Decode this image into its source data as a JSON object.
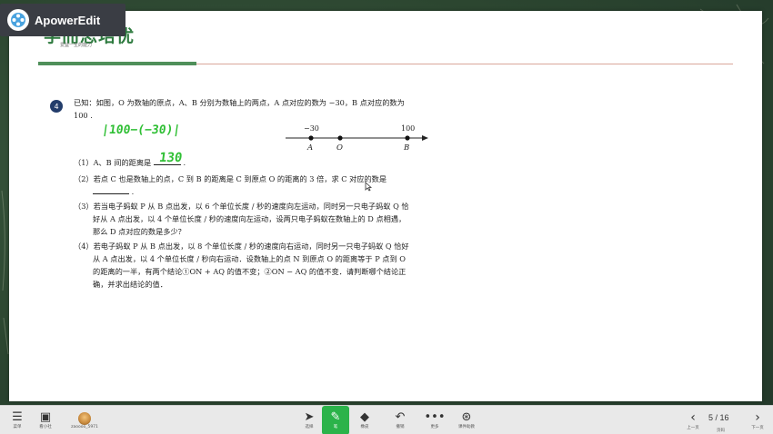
{
  "watermark": {
    "label": "ApowerEdit"
  },
  "slide": {
    "logo": "学而思培优",
    "logo_sub": "爱益一生的能力"
  },
  "problem": {
    "number": "4",
    "intro_line1": "已知：如图，O 为数轴的原点，A、B 分别为数轴上的两点，A 点对应的数为 −30，B 点对应的数为",
    "intro_line2": "100 .",
    "handwrite_calc": "|100−(−30)|",
    "handwrite_answer": "130",
    "number_line": {
      "labels_top": [
        "−30",
        "100"
      ],
      "labels_bottom": [
        "A",
        "O",
        "B"
      ]
    },
    "q1": "（1）A、B 间的距离是",
    "q1_end": ".",
    "q2_line1": "（2）若点 C 也是数轴上的点，C 到 B 的距离是 C 到原点 O 的距离的 3 倍，求 C 对应的数是",
    "q2_line2_end": ".",
    "q3_line1": "（3）若当电子蚂蚁 P 从 B 点出发，以 6 个单位长度 / 秒的速度向左运动，同时另一只电子蚂蚁 Q 恰",
    "q3_line2": "好从 A 点出发，以 4 个单位长度 / 秒的速度向左运动，设两只电子蚂蚁在数轴上的 D 点相遇，",
    "q3_line3": "那么 D 点对应的数是多少？",
    "q4_line1": "（4）若电子蚂蚁 P 从 B 点出发，以 8 个单位长度 / 秒的速度向右运动，同时另一只电子蚂蚁 Q 恰好",
    "q4_line2": "从 A 点出发，以 4 个单位长度 / 秒向右运动．设数轴上的点 N 到原点 O 的距离等于 P 点到 O",
    "q4_line3": "的距离的一半，有两个结论①ON + AQ 的值不变；②ON − AQ 的值不变．请判断哪个结论正",
    "q4_line4": "确，并求出结论的值．"
  },
  "toolbar": {
    "menu_label": "菜单",
    "board_label": "看小社",
    "user_label": "zaoooo_5971",
    "select_label": "选择",
    "pen_label": "笔",
    "eraser_label": "橡皮",
    "undo_label": "撤销",
    "more_label": "更多",
    "ai_label": "课件助教",
    "prev_label": "上一页",
    "page_label": "页码",
    "next_label": "下一页",
    "page_indicator": "5 / 16",
    "accent": "#2bb34a"
  }
}
